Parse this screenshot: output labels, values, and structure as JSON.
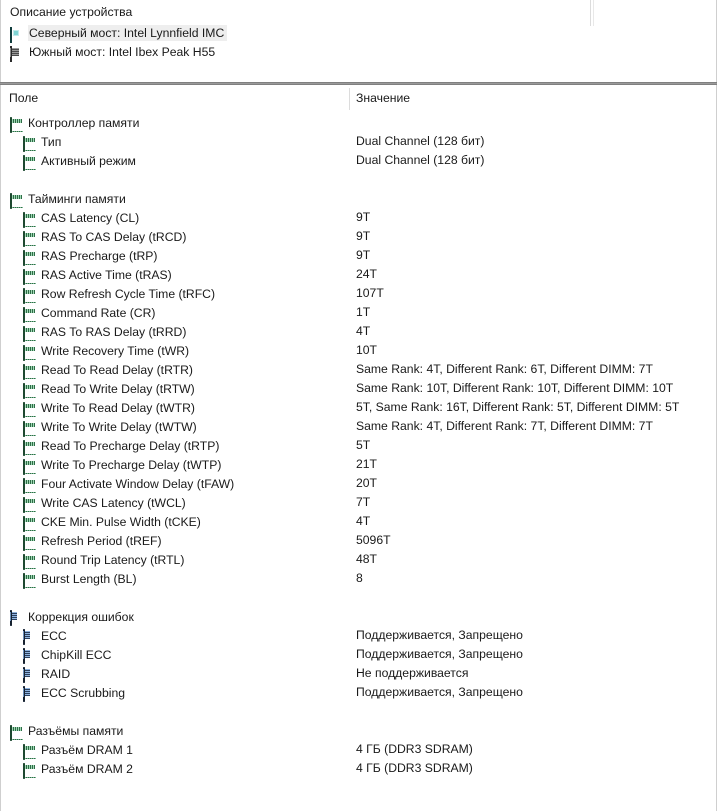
{
  "top_panel": {
    "column_header": "Описание устройства",
    "devices": [
      {
        "icon": "chip-northbridge-icon",
        "label": "Северный мост: Intel Lynnfield IMC",
        "selected": true
      },
      {
        "icon": "chip-southbridge-icon",
        "label": "Южный мост: Intel Ibex Peak H55",
        "selected": false
      }
    ]
  },
  "list_panel": {
    "headers": {
      "field": "Поле",
      "value": "Значение"
    },
    "sections": [
      {
        "title": "Контроллер памяти",
        "icon": "dimm-icon",
        "rows": [
          {
            "field": "Тип",
            "value": "Dual Channel  (128 бит)",
            "icon": "dimm-icon"
          },
          {
            "field": "Активный режим",
            "value": "Dual Channel  (128 бит)",
            "icon": "dimm-icon"
          }
        ]
      },
      {
        "title": "Тайминги памяти",
        "icon": "dimm-icon",
        "rows": [
          {
            "field": "CAS Latency (CL)",
            "value": "9T",
            "icon": "dimm-icon"
          },
          {
            "field": "RAS To CAS Delay (tRCD)",
            "value": "9T",
            "icon": "dimm-icon"
          },
          {
            "field": "RAS Precharge (tRP)",
            "value": "9T",
            "icon": "dimm-icon"
          },
          {
            "field": "RAS Active Time (tRAS)",
            "value": "24T",
            "icon": "dimm-icon"
          },
          {
            "field": "Row Refresh Cycle Time (tRFC)",
            "value": "107T",
            "icon": "dimm-icon"
          },
          {
            "field": "Command Rate (CR)",
            "value": "1T",
            "icon": "dimm-icon"
          },
          {
            "field": "RAS To RAS Delay (tRRD)",
            "value": "4T",
            "icon": "dimm-icon"
          },
          {
            "field": "Write Recovery Time (tWR)",
            "value": "10T",
            "icon": "dimm-icon"
          },
          {
            "field": "Read To Read Delay (tRTR)",
            "value": "Same Rank: 4T, Different Rank: 6T, Different DIMM: 7T",
            "icon": "dimm-icon"
          },
          {
            "field": "Read To Write Delay (tRTW)",
            "value": "Same Rank: 10T, Different Rank: 10T, Different DIMM: 10T",
            "icon": "dimm-icon"
          },
          {
            "field": "Write To Read Delay (tWTR)",
            "value": "5T, Same Rank: 16T, Different Rank: 5T, Different DIMM: 5T",
            "icon": "dimm-icon"
          },
          {
            "field": "Write To Write Delay (tWTW)",
            "value": "Same Rank: 4T, Different Rank: 7T, Different DIMM: 7T",
            "icon": "dimm-icon"
          },
          {
            "field": "Read To Precharge Delay (tRTP)",
            "value": "5T",
            "icon": "dimm-icon"
          },
          {
            "field": "Write To Precharge Delay (tWTP)",
            "value": "21T",
            "icon": "dimm-icon"
          },
          {
            "field": "Four Activate Window Delay (tFAW)",
            "value": "20T",
            "icon": "dimm-icon"
          },
          {
            "field": "Write CAS Latency (tWCL)",
            "value": "7T",
            "icon": "dimm-icon"
          },
          {
            "field": "CKE Min. Pulse Width (tCKE)",
            "value": "4T",
            "icon": "dimm-icon"
          },
          {
            "field": "Refresh Period (tREF)",
            "value": "5096T",
            "icon": "dimm-icon"
          },
          {
            "field": "Round Trip Latency (tRTL)",
            "value": "48T",
            "icon": "dimm-icon"
          },
          {
            "field": "Burst Length (BL)",
            "value": "8",
            "icon": "dimm-icon"
          }
        ]
      },
      {
        "title": "Коррекция ошибок",
        "icon": "ecc-module-icon",
        "rows": [
          {
            "field": "ECC",
            "value": "Поддерживается, Запрещено",
            "icon": "ecc-module-icon"
          },
          {
            "field": "ChipKill ECC",
            "value": "Поддерживается, Запрещено",
            "icon": "ecc-module-icon"
          },
          {
            "field": "RAID",
            "value": "Не поддерживается",
            "icon": "ecc-module-icon"
          },
          {
            "field": "ECC Scrubbing",
            "value": "Поддерживается, Запрещено",
            "icon": "ecc-module-icon"
          }
        ]
      },
      {
        "title": "Разъёмы памяти",
        "icon": "dimm-icon",
        "rows": [
          {
            "field": "Разъём DRAM 1",
            "value": "4 ГБ  (DDR3 SDRAM)",
            "icon": "dimm-icon"
          },
          {
            "field": "Разъём DRAM 2",
            "value": "4 ГБ  (DDR3 SDRAM)",
            "icon": "dimm-icon"
          }
        ]
      }
    ]
  },
  "colors": {
    "background": "#ffffff",
    "text": "#1a1a1a",
    "divider": "#808080",
    "border": "#cfcfcf",
    "selection": "#eeeeee",
    "dimm_icon_green": "#2f6b47",
    "ecc_icon_blue": "#2b3f5c",
    "northbridge_teal": "#1f6b6b",
    "southbridge_gray": "#4a4a4a"
  }
}
